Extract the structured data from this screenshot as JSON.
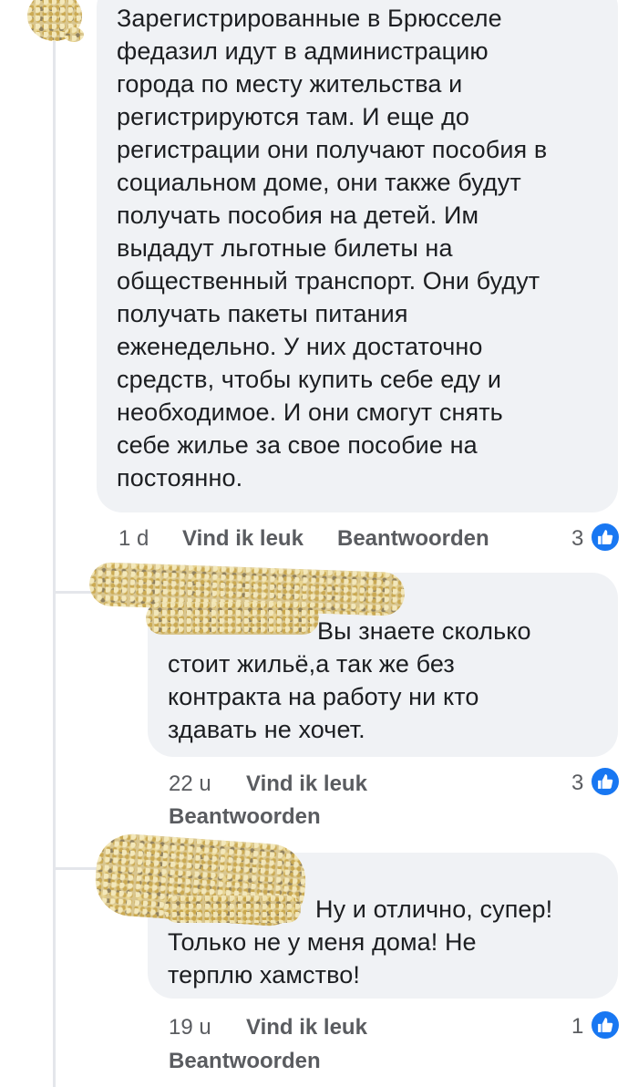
{
  "comments": [
    {
      "author_redacted": true,
      "text": "Зарегистрированные в Брюсселе\nфедазил идут в администрацию\nгорода по месту жительства и\nрегистрируются там.  И еще до\nрегистрации они получают пособия в\nсоциальном доме, они также будут\nполучать пособия на детей. Им\nвыдадут льготные билеты на\nобщественный транспорт. Они будут\nполучать пакеты питания\nеженедельно. У них достаточно\nсредств, чтобы купить себе еду и\nнеобходимое. И они смогут снять\nсебе жилье за свое пособие на\nпостоянно.",
      "time": "1 d",
      "like_label": "Vind ik leuk",
      "reply_label": "Beantwoorden",
      "reaction_count": "3",
      "reaction_icon": "thumbs-up-icon"
    },
    {
      "author_redacted": true,
      "text": "Вы знаете сколько\nстоит жильё,а так же без\nконтракта на работу ни кто\nздавать не хочет.",
      "time": "22 u",
      "like_label": "Vind ik leuk",
      "reply_label": "Beantwoorden",
      "reaction_count": "3",
      "reaction_icon": "thumbs-up-icon"
    },
    {
      "author_redacted": true,
      "text": "Ну и отлично, супер!\nТолько не у меня дома! Не\nтерплю хамство!",
      "time": "19 u",
      "like_label": "Vind ik leuk",
      "reply_label": "Beantwoorden",
      "reaction_count": "1",
      "reaction_icon": "thumbs-up-icon"
    }
  ],
  "colors": {
    "bubble": "#f0f2f5",
    "meta_text": "#5a5c60",
    "like_blue": "#1877f2",
    "redaction": "#d8c48a"
  }
}
